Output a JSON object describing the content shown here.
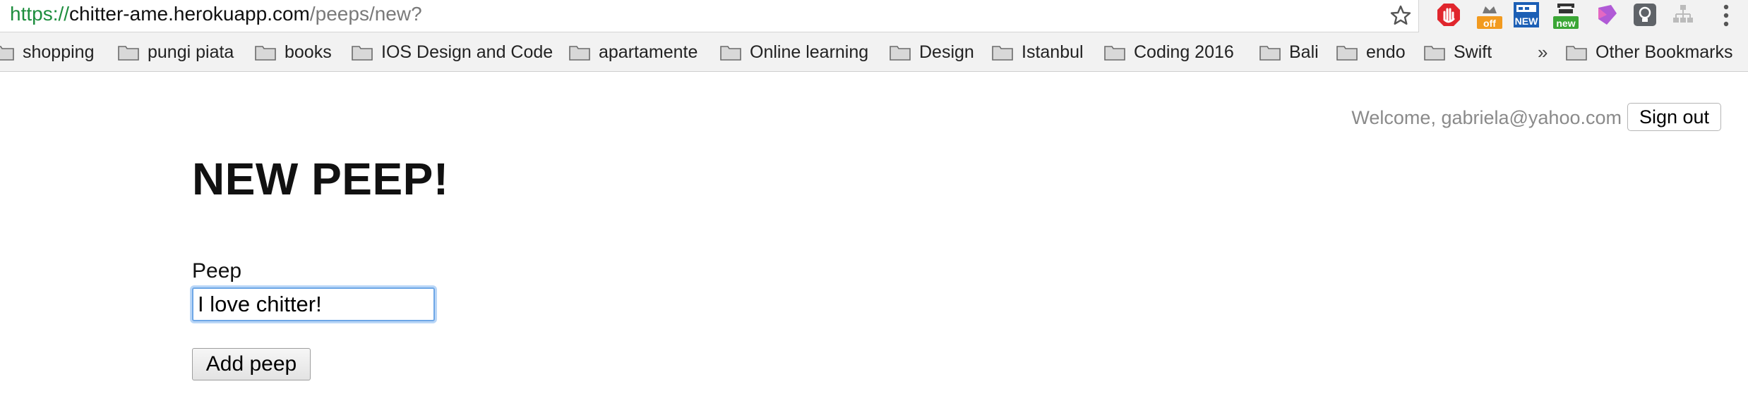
{
  "browser": {
    "url": {
      "scheme": "https://",
      "host": "chitter-ame.herokuapp.com",
      "path": "/peeps/new?"
    },
    "extensions": [
      {
        "name": "adblock-icon",
        "label": ""
      },
      {
        "name": "off-extension-icon",
        "label": "off"
      },
      {
        "name": "new-extension-icon",
        "label": "NEW"
      },
      {
        "name": "new-badge-extension-icon",
        "label": "new"
      },
      {
        "name": "pocket-extension-icon",
        "label": ""
      },
      {
        "name": "lightbulb-extension-icon",
        "label": ""
      },
      {
        "name": "sitemap-extension-icon",
        "label": ""
      }
    ],
    "colors": {
      "url_scheme": "#1e8e3e",
      "focus_ring": "#6ea7e6"
    }
  },
  "bookmarks": {
    "items": [
      "shopping",
      "pungi piata",
      "books",
      "IOS Design and Code",
      "apartamente",
      "Online learning",
      "Design",
      "Istanbul",
      "Coding 2016",
      "Bali",
      "endo",
      "Swift"
    ],
    "overflow": "»",
    "other": "Other Bookmarks"
  },
  "header": {
    "welcome": "Welcome, gabriela@yahoo.com",
    "sign_out": "Sign out"
  },
  "main": {
    "title": "NEW PEEP!",
    "peep_label": "Peep",
    "peep_value": "I love chitter!",
    "submit": "Add peep"
  }
}
